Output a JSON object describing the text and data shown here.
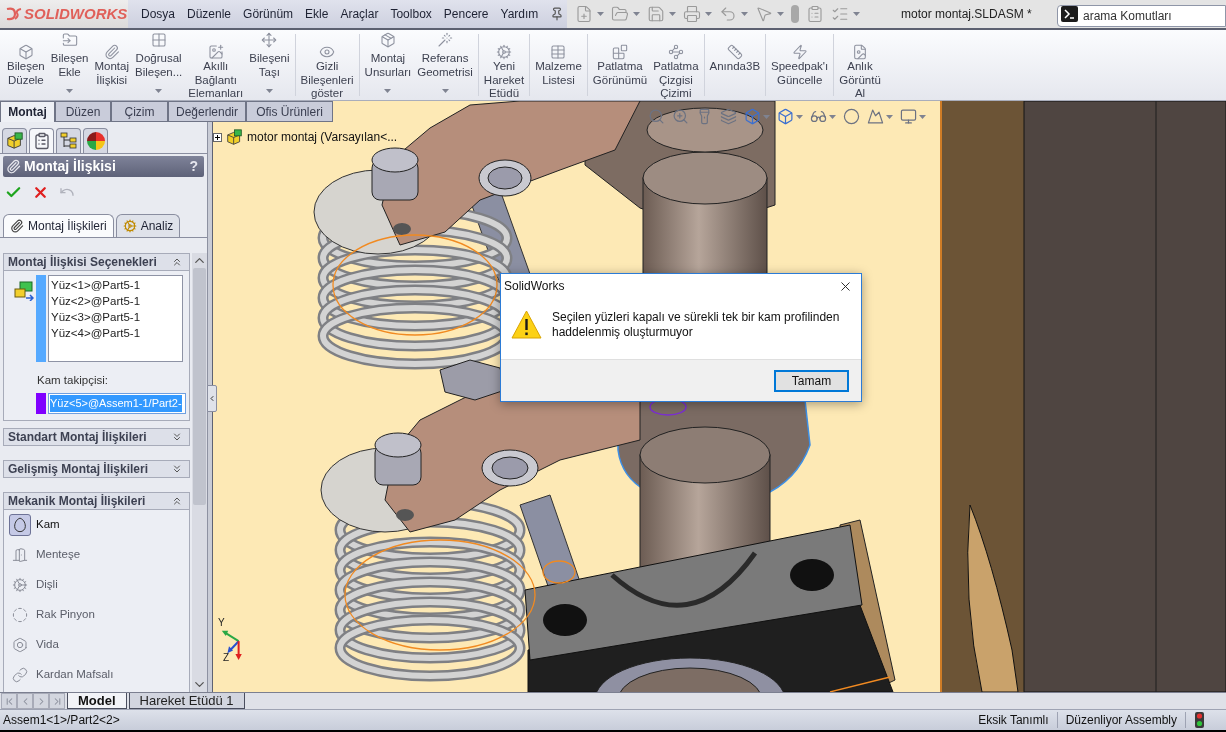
{
  "title_bar": {
    "logo": "SOLIDWORKS",
    "menu": [
      "Dosya",
      "Düzenle",
      "Görünüm",
      "Ekle",
      "Araçlar",
      "Toolbox",
      "Pencere",
      "Yardım"
    ],
    "document_title": "motor montaj.SLDASM *",
    "search": {
      "placeholder": "arama Komutları"
    }
  },
  "command_manager": {
    "groups": [
      {
        "buttons": [
          {
            "lines": [
              "Bileşen",
              "Düzele"
            ],
            "dropdown": false
          },
          {
            "lines": [
              "Bileşen",
              "Ekle"
            ],
            "dropdown": true
          },
          {
            "lines": [
              "Montaj",
              "İlişkisi"
            ],
            "dropdown": false
          },
          {
            "lines": [
              "Doğrusal",
              "Bileşen..."
            ],
            "dropdown": true
          },
          {
            "lines": [
              "Akıllı",
              "Bağlantı",
              "Elemanları"
            ],
            "dropdown": false
          },
          {
            "lines": [
              "Bileşeni",
              "Taşı"
            ],
            "dropdown": true
          }
        ]
      },
      {
        "buttons": [
          {
            "lines": [
              "Gizli",
              "Bileşenleri",
              "göster"
            ],
            "dropdown": false
          }
        ]
      },
      {
        "buttons": [
          {
            "lines": [
              "Montaj",
              "Unsurları"
            ],
            "dropdown": true
          },
          {
            "lines": [
              "Referans",
              "Geometrisi"
            ],
            "dropdown": true
          }
        ]
      },
      {
        "buttons": [
          {
            "lines": [
              "Yeni",
              "Hareket",
              "Etüdü"
            ],
            "dropdown": false
          }
        ]
      },
      {
        "buttons": [
          {
            "lines": [
              "Malzeme",
              "Listesi"
            ],
            "dropdown": false
          }
        ]
      },
      {
        "buttons": [
          {
            "lines": [
              "Patlatma",
              "Görünümü"
            ],
            "dropdown": false
          },
          {
            "lines": [
              "Patlatma",
              "Çizgisi",
              "Çizimi"
            ],
            "dropdown": false
          }
        ]
      },
      {
        "buttons": [
          {
            "lines": [
              "Anında3B"
            ],
            "dropdown": false
          }
        ]
      },
      {
        "buttons": [
          {
            "lines": [
              "Speedpak'ı",
              "Güncelle"
            ],
            "dropdown": false
          }
        ]
      },
      {
        "buttons": [
          {
            "lines": [
              "Anlık",
              "Görüntü",
              "Al"
            ],
            "dropdown": false
          }
        ]
      }
    ],
    "tabs": [
      {
        "label": "Montaj",
        "selected": true
      },
      {
        "label": "Düzen",
        "selected": false
      },
      {
        "label": "Çizim",
        "selected": false
      },
      {
        "label": "Değerlendir",
        "selected": false
      },
      {
        "label": "Ofis Ürünleri",
        "selected": false
      }
    ]
  },
  "manager_tabs": [
    {
      "selected": false
    },
    {
      "selected": true
    },
    {
      "selected": false
    },
    {
      "selected": false
    }
  ],
  "property_manager": {
    "title": "Montaj İlişkisi",
    "help": "?",
    "tabs": [
      {
        "label": "Montaj İlişkileri",
        "selected": true
      },
      {
        "label": "Analiz",
        "selected": false
      }
    ],
    "sections": [
      {
        "kind": "selection",
        "title": "Montaj İlişkisi Seçenekleri",
        "expanded": true,
        "faces": {
          "color": "#55a9ff",
          "items": [
            "Yüz<1>@Part5-1",
            "Yüz<2>@Part5-1",
            "Yüz<3>@Part5-1",
            "Yüz<4>@Part5-1"
          ]
        },
        "follower": {
          "label": "Kam takipçisi:",
          "color": "#8000ff",
          "value": "Yüz<5>@Assem1-1/Part2-",
          "selected": true
        }
      },
      {
        "title": "Standart Montaj İlişkileri",
        "expanded": false
      },
      {
        "title": "Gelişmiş Montaj İlişkileri",
        "expanded": false
      },
      {
        "kind": "list",
        "title": "Mekanik Montaj İlişkileri",
        "expanded": true,
        "items": [
          {
            "label": "Kam",
            "selected": true
          },
          {
            "label": "Menteşe",
            "selected": false
          },
          {
            "label": "Dişli",
            "selected": false
          },
          {
            "label": "Rak Pinyon",
            "selected": false
          },
          {
            "label": "Vida",
            "selected": false
          },
          {
            "label": "Kardan Mafsalı",
            "selected": false
          }
        ]
      }
    ]
  },
  "feature_tree": {
    "root": "motor montaj (Varsayılan<...",
    "expanded": false
  },
  "triad": {
    "labels": [
      "Y",
      "Z"
    ]
  },
  "dialog": {
    "title": "SolidWorks",
    "message": "Seçilen yüzleri kapalı ve sürekli tek bir kam profilinden haddelenmiş oluşturmuyor",
    "buttons": [
      "Tamam"
    ]
  },
  "model_tabs": [
    {
      "label": "Model",
      "selected": true
    },
    {
      "label": "Hareket Etüdü 1",
      "selected": false
    }
  ],
  "status_bar": {
    "path": "Assem1<1>/Part2<2>",
    "fields": [
      "Eksik Tanımlı",
      "Düzenliyor Assembly"
    ]
  }
}
